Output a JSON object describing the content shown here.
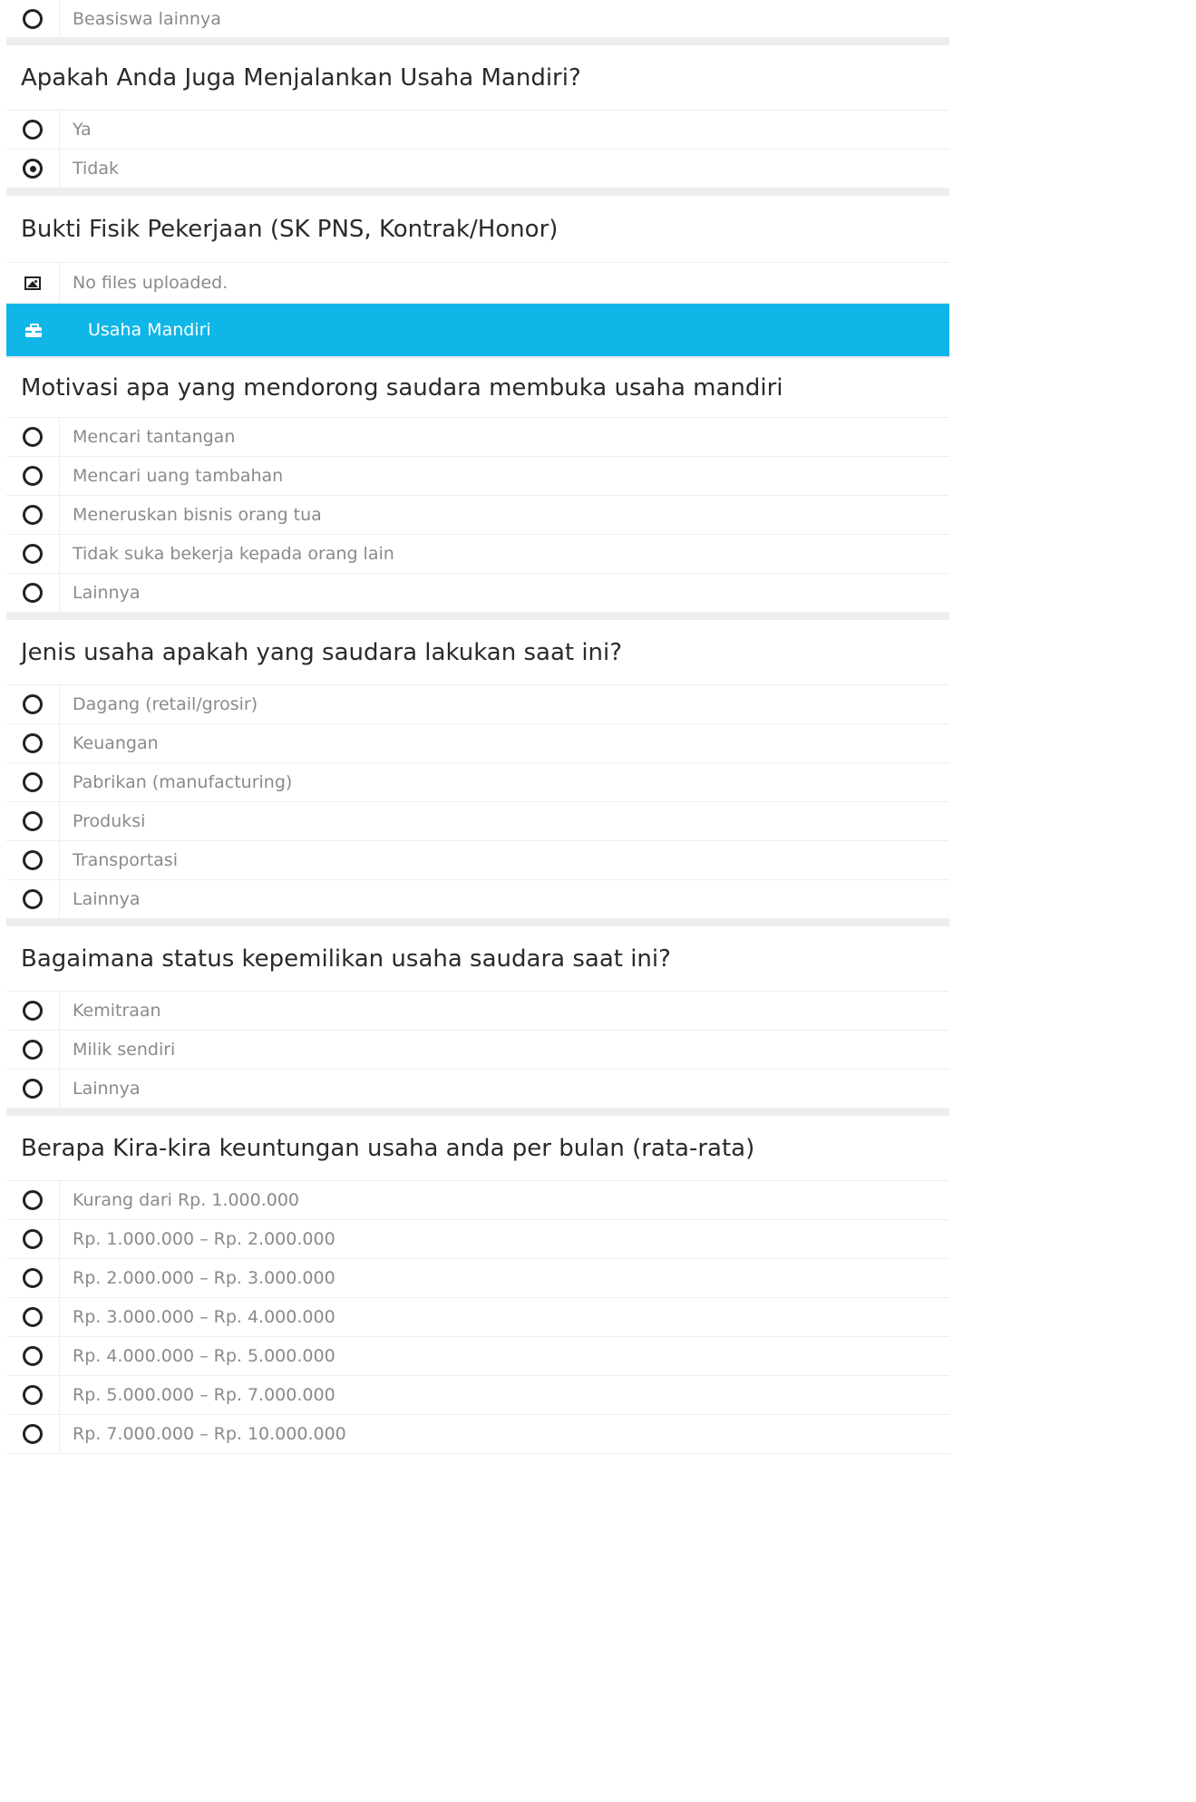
{
  "top_option": {
    "label": "Beasiswa lainnya",
    "selected": false
  },
  "q_usaha": {
    "title": "Apakah Anda Juga Menjalankan Usaha Mandiri?",
    "options": [
      {
        "label": "Ya",
        "selected": false
      },
      {
        "label": "Tidak",
        "selected": true
      }
    ]
  },
  "q_bukti": {
    "title": "Bukti Fisik Pekerjaan (SK PNS, Kontrak/Honor)",
    "upload_status": "No files uploaded.",
    "icon": "image-icon"
  },
  "section": {
    "label": "Usaha Mandiri",
    "icon": "briefcase-icon",
    "color": "#11b6e8"
  },
  "q_motivasi": {
    "title": "Motivasi apa yang mendorong saudara membuka usaha mandiri",
    "options": [
      {
        "label": "Mencari tantangan",
        "selected": false
      },
      {
        "label": "Mencari uang tambahan",
        "selected": false
      },
      {
        "label": "Meneruskan bisnis orang tua",
        "selected": false
      },
      {
        "label": "Tidak suka bekerja kepada orang lain",
        "selected": false
      },
      {
        "label": "Lainnya",
        "selected": false
      }
    ]
  },
  "q_jenis": {
    "title": "Jenis usaha apakah yang saudara lakukan saat ini?",
    "options": [
      {
        "label": "Dagang (retail/grosir)",
        "selected": false
      },
      {
        "label": "Keuangan",
        "selected": false
      },
      {
        "label": "Pabrikan (manufacturing)",
        "selected": false
      },
      {
        "label": "Produksi",
        "selected": false
      },
      {
        "label": "Transportasi",
        "selected": false
      },
      {
        "label": "Lainnya",
        "selected": false
      }
    ]
  },
  "q_status": {
    "title": "Bagaimana status kepemilikan usaha saudara saat ini?",
    "options": [
      {
        "label": "Kemitraan",
        "selected": false
      },
      {
        "label": "Milik sendiri",
        "selected": false
      },
      {
        "label": "Lainnya",
        "selected": false
      }
    ]
  },
  "q_keuntungan": {
    "title": "Berapa Kira-kira keuntungan usaha anda per bulan (rata-rata)",
    "options": [
      {
        "label": "Kurang dari Rp. 1.000.000",
        "selected": false
      },
      {
        "label": "Rp. 1.000.000 – Rp. 2.000.000",
        "selected": false
      },
      {
        "label": "Rp. 2.000.000 – Rp. 3.000.000",
        "selected": false
      },
      {
        "label": "Rp. 3.000.000 – Rp. 4.000.000",
        "selected": false
      },
      {
        "label": "Rp. 4.000.000 – Rp. 5.000.000",
        "selected": false
      },
      {
        "label": "Rp. 5.000.000 – Rp. 7.000.000",
        "selected": false
      },
      {
        "label": "Rp. 7.000.000 – Rp. 10.000.000",
        "selected": false
      }
    ]
  }
}
